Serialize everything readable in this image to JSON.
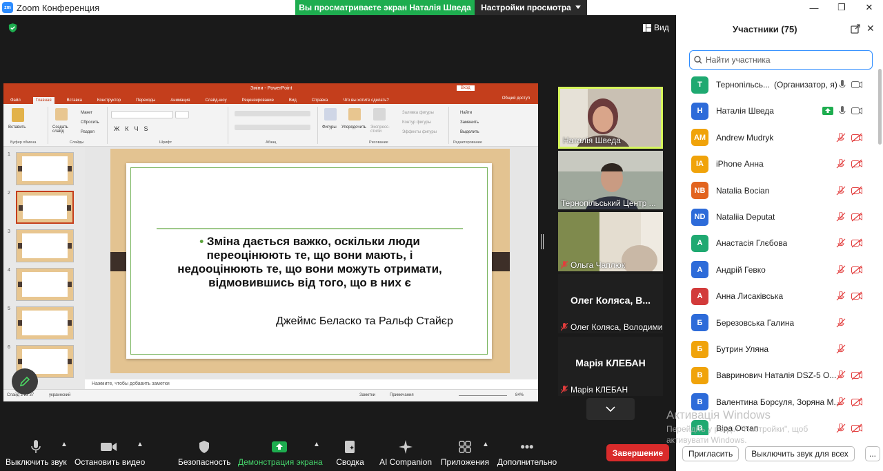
{
  "window": {
    "title": "Zoom Конференция",
    "logo_text": "zm"
  },
  "share_banner": {
    "message": "Вы просматриваете экран Наталія Шведа",
    "options_label": "Настройки просмотра"
  },
  "view_button": "Вид",
  "powerpoint": {
    "title": "Зміни  -  PowerPoint",
    "login": "Вход",
    "tabs": [
      "Файл",
      "Главная",
      "Вставка",
      "Конструктор",
      "Переходы",
      "Анимация",
      "Слайд-шоу",
      "Рецензирование",
      "Вид",
      "Справка",
      "Что вы хотите сделать?"
    ],
    "share": "Общий доступ",
    "ribbon": {
      "paste": "Вставить",
      "new_slide": "Создать слайд",
      "layout": "Макет",
      "reset": "Сбросить",
      "section": "Раздел",
      "shapes": "Фигуры",
      "arrange": "Упорядочить",
      "quick_styles": "Экспресс-стили",
      "fill": "Заливка фигуры",
      "outline": "Контур фигуры",
      "effects": "Эффекты фигуры",
      "find": "Найти",
      "replace": "Заменить",
      "select": "Выделить",
      "groups": [
        "Буфер обмена",
        "Слайды",
        "Шрифт",
        "Абзац",
        "Рисование",
        "Редактирование"
      ]
    },
    "thumbnails": [
      "1",
      "2",
      "3",
      "4",
      "5",
      "6"
    ],
    "selected_thumbnail": 2,
    "slide": {
      "quote_line1": "Зміна дається важко, оскільки люди",
      "quote_line2": "переоцінюють те, що вони мають, і",
      "quote_line3": "недооцінюють те, що вони можуть отримати,",
      "quote_line4": "відмовившись від того, що в них є",
      "author": "Джеймс Беласко та Ральф Стайєр"
    },
    "notes_placeholder": "Нажмите, чтобы добавить заметки",
    "status": {
      "slide_info": "Слайд 2 из 37",
      "language": "украинский",
      "notes": "Заметки",
      "comments": "Примечания",
      "zoom": "84%"
    }
  },
  "videos": [
    {
      "name": "Наталія Шведа",
      "active": true,
      "muted": false,
      "big": ""
    },
    {
      "name": "Тернопільський Центр ...",
      "active": false,
      "muted": false,
      "big": ""
    },
    {
      "name": "Ольга Чаплюк",
      "active": false,
      "muted": true,
      "big": ""
    },
    {
      "name": "Олег Коляса, Володими...",
      "active": false,
      "muted": true,
      "big": "Олег Коляса, В..."
    },
    {
      "name": "Марія КЛЕБАН",
      "active": false,
      "muted": true,
      "big": "Марія КЛЕБАН"
    }
  ],
  "toolbar": {
    "mute": "Выключить звук",
    "stop_video": "Остановить видео",
    "security": "Безопасность",
    "share": "Демонстрация экрана",
    "summary": "Сводка",
    "ai": "AI Companion",
    "apps": "Приложения",
    "more": "Дополнительно",
    "end": "Завершение"
  },
  "watermark": {
    "line1": "Активація Windows",
    "line2": "Перейдіть у розділ \"Настройки\", щоб",
    "line3": "активувати Windows."
  },
  "participants_panel": {
    "title": "Участники (75)",
    "search_placeholder": "Найти участника",
    "participants": [
      {
        "initials": "Т",
        "name": "Тернопільсь...",
        "role": "(Организатор, я)",
        "color": "#1fa971",
        "mic": "on",
        "video": "off-plain",
        "share": false
      },
      {
        "initials": "Н",
        "name": "Наталія Шведа",
        "role": "",
        "color": "#2d6bd9",
        "mic": "on",
        "video": "off-plain",
        "share": true
      },
      {
        "initials": "AM",
        "name": "Andrew Mudryk",
        "role": "",
        "color": "#f0a30a",
        "mic": "muted",
        "video": "muted",
        "share": false
      },
      {
        "initials": "IA",
        "name": "iPhone Анна",
        "role": "",
        "color": "#f0a30a",
        "mic": "muted",
        "video": "muted",
        "share": false
      },
      {
        "initials": "NB",
        "name": "Natalia Bocian",
        "role": "",
        "color": "#e2641f",
        "mic": "muted",
        "video": "muted",
        "share": false
      },
      {
        "initials": "ND",
        "name": "Nataliia Deputat",
        "role": "",
        "color": "#2d6bd9",
        "mic": "muted",
        "video": "muted",
        "share": false
      },
      {
        "initials": "А",
        "name": "Анастасія Глєбова",
        "role": "",
        "color": "#1fa971",
        "mic": "muted",
        "video": "muted",
        "share": false
      },
      {
        "initials": "А",
        "name": "Андрій Гевко",
        "role": "",
        "color": "#2d6bd9",
        "mic": "muted",
        "video": "muted",
        "share": false
      },
      {
        "initials": "А",
        "name": "Анна Лисаківська",
        "role": "",
        "color": "#d23a3a",
        "mic": "muted",
        "video": "muted",
        "share": false
      },
      {
        "initials": "Б",
        "name": "Березовська Галина",
        "role": "",
        "color": "#2d6bd9",
        "mic": "muted",
        "video": "none",
        "share": false
      },
      {
        "initials": "Б",
        "name": "Бутрин Уляна",
        "role": "",
        "color": "#f0a30a",
        "mic": "muted",
        "video": "none",
        "share": false
      },
      {
        "initials": "В",
        "name": "Вавринович Наталія DSZ-5 О...",
        "role": "",
        "color": "#f0a30a",
        "mic": "muted",
        "video": "muted",
        "share": false
      },
      {
        "initials": "В",
        "name": "Валентина Борсуля, Зоряна М...",
        "role": "",
        "color": "#2d6bd9",
        "mic": "muted",
        "video": "muted",
        "share": false
      },
      {
        "initials": "В",
        "name": "Віра Остап",
        "role": "",
        "color": "#1fa971",
        "mic": "muted",
        "video": "muted",
        "share": false
      }
    ],
    "invite_button": "Пригласить",
    "mute_all_button": "Выключить звук для всех",
    "more_button": "..."
  },
  "colors": {
    "accent": "#2d8cff",
    "share_green": "#1ead4f",
    "end_red": "#d92b2b",
    "ppt_orange": "#c43e1c",
    "active_speaker": "#d5f55c"
  }
}
